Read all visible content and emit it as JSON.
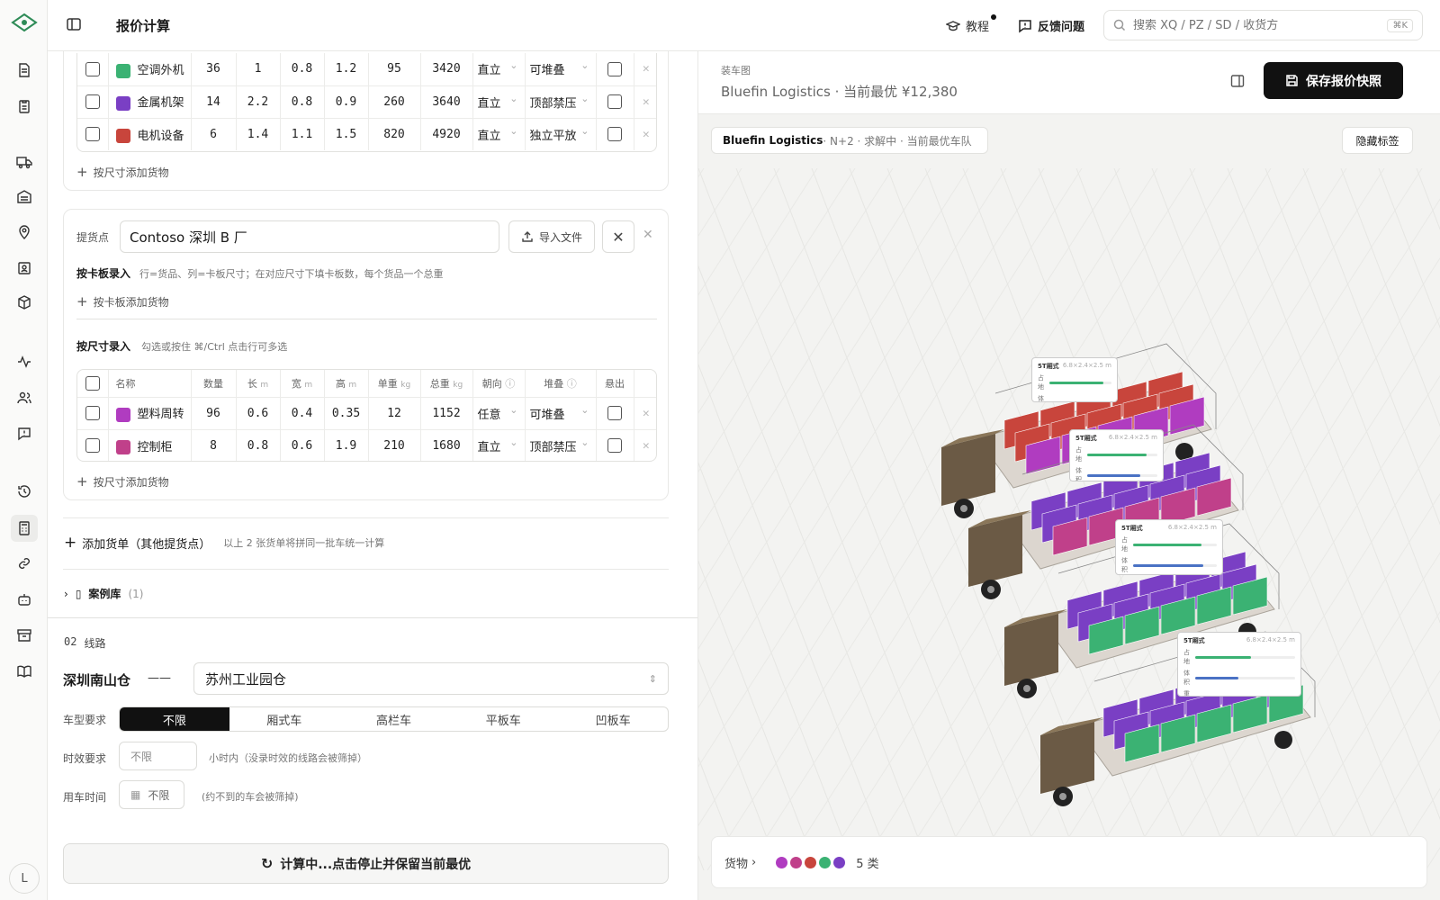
{
  "header": {
    "title": "报价计算",
    "tutorial": "教程",
    "feedback": "反馈问题",
    "search_placeholder": "搜索 XQ / PZ / SD / 收货方",
    "search_kbd": "⌘K"
  },
  "rail": {
    "avatar": "L"
  },
  "cargo_top": {
    "rows": [
      {
        "color": "#3bb273",
        "name": "空调外机",
        "qty": "36",
        "l": "1",
        "w": "0.8",
        "h": "1.2",
        "unit_kg": "95",
        "total_kg": "3420",
        "orient": "直立",
        "stack": "可堆叠"
      },
      {
        "color": "#7a3fc4",
        "name": "金属机架",
        "qty": "14",
        "l": "2.2",
        "w": "0.8",
        "h": "0.9",
        "unit_kg": "260",
        "total_kg": "3640",
        "orient": "直立",
        "stack": "顶部禁压"
      },
      {
        "color": "#c8453c",
        "name": "电机设备",
        "qty": "6",
        "l": "1.4",
        "w": "1.1",
        "h": "1.5",
        "unit_kg": "820",
        "total_kg": "4920",
        "orient": "直立",
        "stack": "独立平放"
      }
    ],
    "add_by_size": "按尺寸添加货物"
  },
  "pickup": {
    "label": "提货点",
    "value": "Contoso 深圳 B 厂",
    "import": "导入文件",
    "pallet_title": "按卡板录入",
    "pallet_hint": "行=货品、列=卡板尺寸；在对应尺寸下填卡板数，每个货品一个总重",
    "add_by_pallet": "按卡板添加货物",
    "size_title": "按尺寸录入",
    "size_hint": "勾选或按住 ⌘/Ctrl 点击行可多选",
    "cols": {
      "name": "名称",
      "qty": "数量",
      "l": "长",
      "w": "宽",
      "h": "高",
      "unit": "单重",
      "total": "总重",
      "orient": "朝向",
      "stack": "堆叠",
      "overhang": "悬出",
      "u_m": "m",
      "u_kg": "kg"
    },
    "rows": [
      {
        "color": "#b03cc0",
        "name": "塑料周转",
        "qty": "96",
        "l": "0.6",
        "w": "0.4",
        "h": "0.35",
        "unit_kg": "12",
        "total_kg": "1152",
        "orient": "任意",
        "stack": "可堆叠"
      },
      {
        "color": "#c0408a",
        "name": "控制柜",
        "qty": "8",
        "l": "0.8",
        "w": "0.6",
        "h": "1.9",
        "unit_kg": "210",
        "total_kg": "1680",
        "orient": "直立",
        "stack": "顶部禁压"
      }
    ],
    "add_by_size": "按尺寸添加货物"
  },
  "add_order": {
    "label": "添加货单（其他提货点）",
    "hint": "以上 2 张货单将拼同一批车统一计算"
  },
  "cases": {
    "label": "案例库",
    "count": "(1)"
  },
  "route": {
    "num": "02",
    "title": "线路",
    "from": "深圳南山仓",
    "dash": "——",
    "to": "苏州工业园仓",
    "vehicle_label": "车型要求",
    "vehicle_opts": [
      "不限",
      "厢式车",
      "高栏车",
      "平板车",
      "凹板车"
    ],
    "time_label": "时效要求",
    "time_value": "不限",
    "time_hint": "小时内（没录时效的线路会被筛掉）",
    "use_label": "用车时间",
    "use_value": "不限",
    "use_hint": "(约不到的车会被筛掉)"
  },
  "calc": {
    "label": "计算中...点击停止并保留当前最优"
  },
  "plan": {
    "caption": "装车图",
    "subtitle": "Bluefin Logistics · 当前最优 ¥12,380",
    "save": "保存报价快照",
    "badge_name": "Bluefin Logistics",
    "badge_rest": " · N+2 · 求解中 · 当前最优车队",
    "hide_tags": "隐藏标签",
    "truck_label": "5T厢式",
    "truck_dims": "6.8×2.4×2.5 m",
    "letters": [
      "占地",
      "体积",
      "重量"
    ],
    "cargo_label": "货物",
    "cargo_count": "5 类"
  },
  "colors": {
    "green": "#3bb273",
    "purple": "#7a3fc4",
    "red": "#c8453c",
    "violet": "#b03cc0",
    "magenta": "#c0408a"
  }
}
